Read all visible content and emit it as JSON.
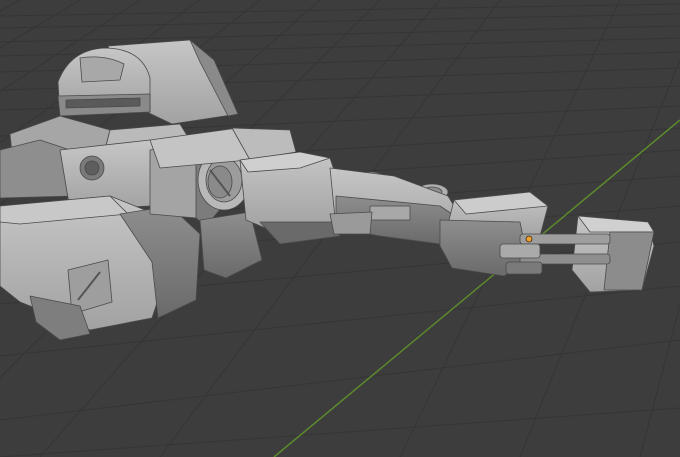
{
  "viewport": {
    "background": "#3d3d3d",
    "grid_color": "#353535",
    "grid_major_color": "#323232",
    "x_axis_color": "#5c8a2c",
    "model_light": "#b5b5b5",
    "model_mid": "#9a9a9a",
    "model_dark": "#6f6f6f",
    "model_shadow": "#4c4c4c",
    "origin_marker_color": "#f0a030",
    "object": "mech-model",
    "shading": "solid"
  }
}
